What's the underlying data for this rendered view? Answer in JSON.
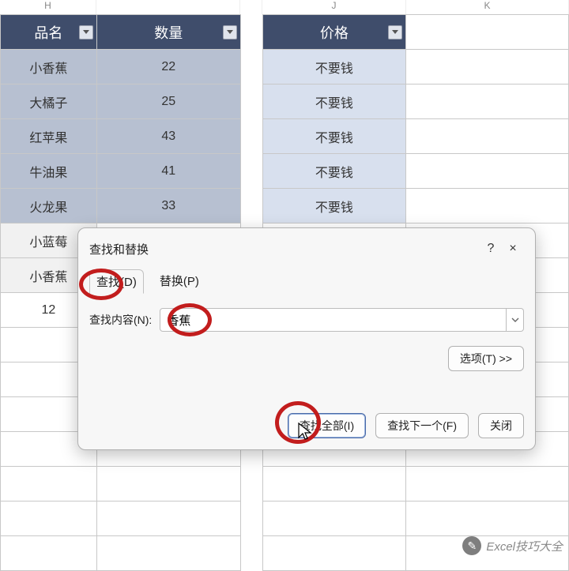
{
  "columns": {
    "h": "H",
    "j": "J",
    "k": "K"
  },
  "table": {
    "headers": {
      "name": "品名",
      "qty": "数量",
      "price": "价格"
    },
    "rows": [
      {
        "name": "小香蕉",
        "qty": "22",
        "price": "不要钱"
      },
      {
        "name": "大橘子",
        "qty": "25",
        "price": "不要钱"
      },
      {
        "name": "红苹果",
        "qty": "43",
        "price": "不要钱"
      },
      {
        "name": "牛油果",
        "qty": "41",
        "price": "不要钱"
      },
      {
        "name": "火龙果",
        "qty": "33",
        "price": "不要钱"
      },
      {
        "name": "小蓝莓",
        "qty": "",
        "price": ""
      },
      {
        "name": "小香蕉",
        "qty": "",
        "price": ""
      },
      {
        "name": "12",
        "qty": "",
        "price": ""
      }
    ]
  },
  "dialog": {
    "title": "查找和替换",
    "help": "?",
    "close": "×",
    "tab_find": "查找(D)",
    "tab_replace": "替换(P)",
    "find_label": "查找内容(N):",
    "find_value": "香蕉",
    "options": "选项(T) >>",
    "find_all": "查找全部(I)",
    "find_next": "查找下一个(F)",
    "close_btn": "关闭"
  },
  "watermark": "Excel技巧大全"
}
